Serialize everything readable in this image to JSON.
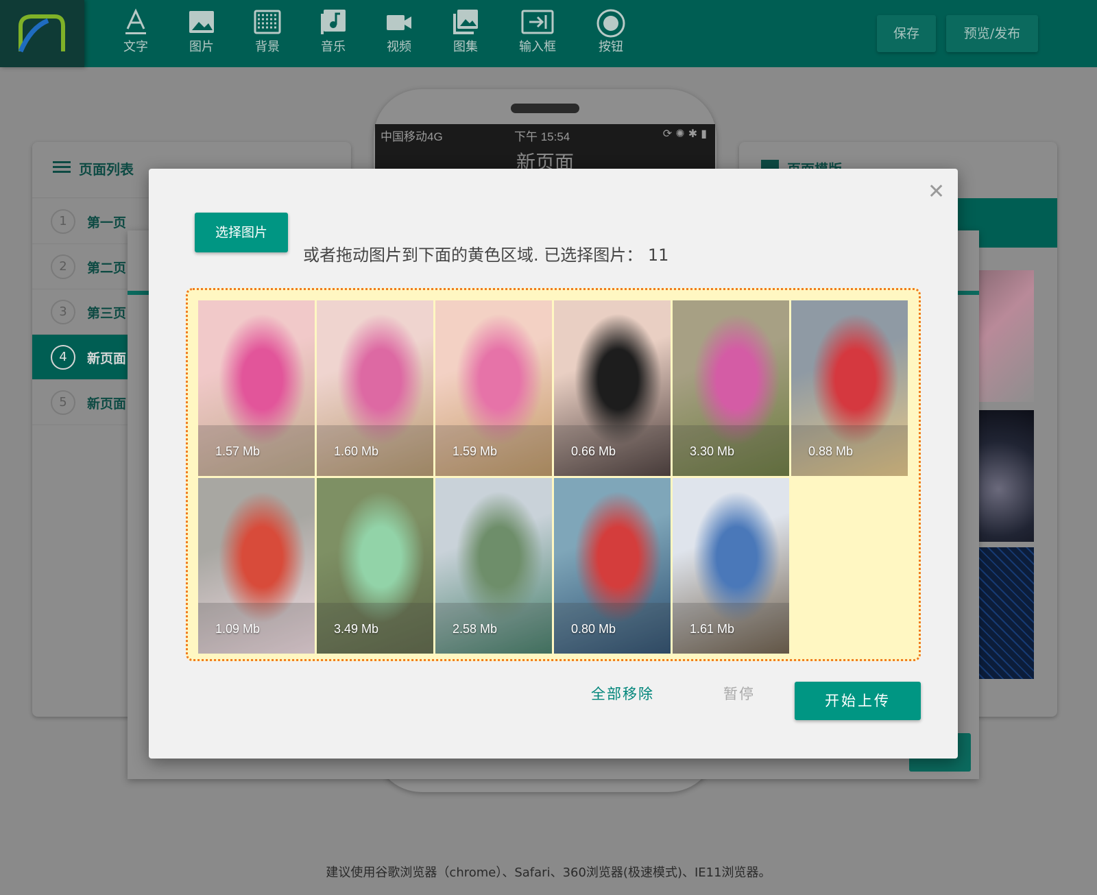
{
  "toolbar": {
    "items": [
      {
        "label": "文字",
        "icon": "text-icon"
      },
      {
        "label": "图片",
        "icon": "image-icon"
      },
      {
        "label": "背景",
        "icon": "background-icon"
      },
      {
        "label": "音乐",
        "icon": "music-icon"
      },
      {
        "label": "视频",
        "icon": "video-icon"
      },
      {
        "label": "图集",
        "icon": "gallery-icon"
      },
      {
        "label": "输入框",
        "icon": "input-icon"
      },
      {
        "label": "按钮",
        "icon": "button-icon"
      }
    ],
    "save_label": "保存",
    "publish_label": "预览/发布"
  },
  "page_list": {
    "title": "页面列表",
    "pages": [
      {
        "num": "1",
        "name": "第一页"
      },
      {
        "num": "2",
        "name": "第二页"
      },
      {
        "num": "3",
        "name": "第三页"
      },
      {
        "num": "4",
        "name": "新页面",
        "active": true
      },
      {
        "num": "5",
        "name": "新页面"
      }
    ]
  },
  "templates": {
    "title": "页面模版"
  },
  "phone": {
    "carrier": "中国移动4G",
    "time": "下午 15:54",
    "status_icons": "⟳ ✺ ✱ ▮",
    "page_title": "新页面"
  },
  "modal": {
    "select_button": "选择图片",
    "hint": "或者拖动图片到下面的黄色区域. 已选择图片： 11",
    "images": [
      {
        "size": "1.57 Mb",
        "palette": [
          "#f1c9c9",
          "#e2559a",
          "#bfa98a"
        ]
      },
      {
        "size": "1.60 Mb",
        "palette": [
          "#efd4cf",
          "#dd69a3",
          "#b89a6f"
        ]
      },
      {
        "size": "1.59 Mb",
        "palette": [
          "#f3d1c4",
          "#e673a8",
          "#c29a65"
        ]
      },
      {
        "size": "0.66 Mb",
        "palette": [
          "#e9cfc3",
          "#1d1d1d",
          "#4b3c3a"
        ]
      },
      {
        "size": "3.30 Mb",
        "palette": [
          "#a7a084",
          "#d45ca5",
          "#6b7b3e"
        ]
      },
      {
        "size": "0.88 Mb",
        "palette": [
          "#8f9aa4",
          "#d5383f",
          "#e8c987"
        ]
      },
      {
        "size": "1.09 Mb",
        "palette": [
          "#a8a7a2",
          "#d84b3a",
          "#f2dde3"
        ]
      },
      {
        "size": "3.49 Mb",
        "palette": [
          "#7e9064",
          "#92d3a8",
          "#5e6848"
        ]
      },
      {
        "size": "2.58 Mb",
        "palette": [
          "#c9d2d9",
          "#6e8e6a",
          "#437e68"
        ]
      },
      {
        "size": "0.80 Mb",
        "palette": [
          "#7fa6b9",
          "#d43d3c",
          "#2c4e6f"
        ]
      },
      {
        "size": "1.61 Mb",
        "palette": [
          "#dfe4ec",
          "#4a78b9",
          "#6e5e4a"
        ]
      }
    ],
    "remove_all_label": "全部移除",
    "pause_label": "暂停",
    "upload_label": "开始上传"
  },
  "footer": "建议使用谷歌浏览器（chrome）、Safari、360浏览器(极速模式)、IE11浏览器。",
  "colors": {
    "brand": "#005e53",
    "accent": "#009683",
    "dropzone_bg": "#fff7c2",
    "dropzone_border": "#f07a1e"
  }
}
